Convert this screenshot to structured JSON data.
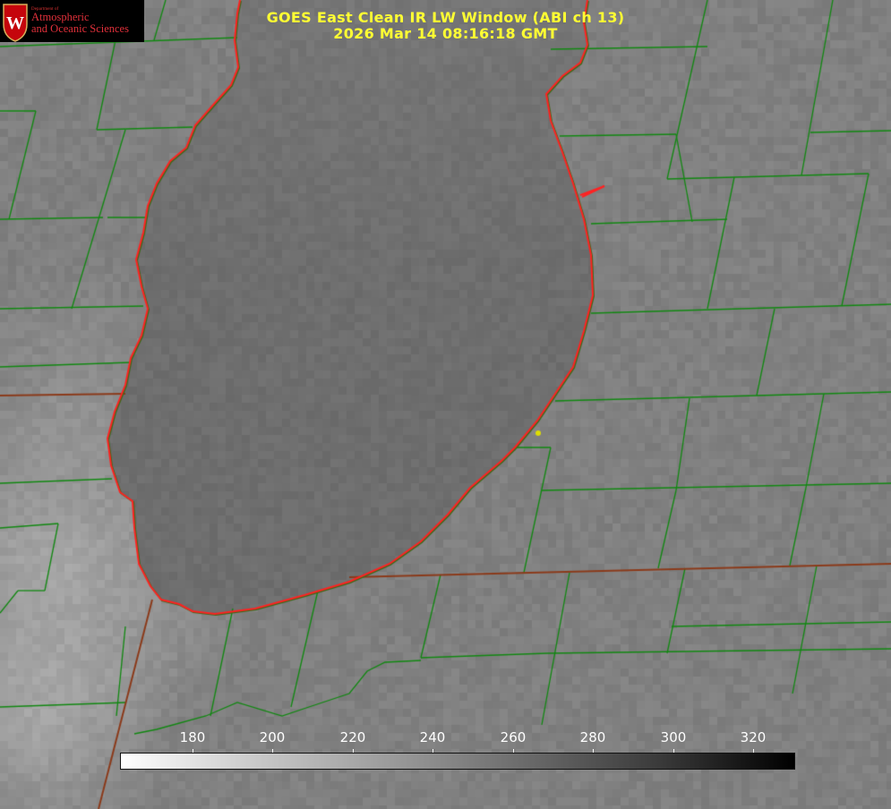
{
  "title": {
    "line1": "GOES East Clean IR LW Window (ABI ch 13)",
    "line2": "2026 Mar 14 08:16:18 GMT"
  },
  "logo": {
    "dept": "Department of",
    "line1": "Atmospheric",
    "line2": "and Oceanic Sciences",
    "crest_letter": "W"
  },
  "colorbar": {
    "ticks": [
      "180",
      "200",
      "220",
      "240",
      "260",
      "280",
      "300",
      "320"
    ]
  },
  "colors": {
    "title": "#ffff33",
    "county_lines": "#118811",
    "state_lines": "#8b3a1a",
    "lake_outline": "#ff2222",
    "logo_text": "#e0303a",
    "marker": "#dddd00"
  }
}
